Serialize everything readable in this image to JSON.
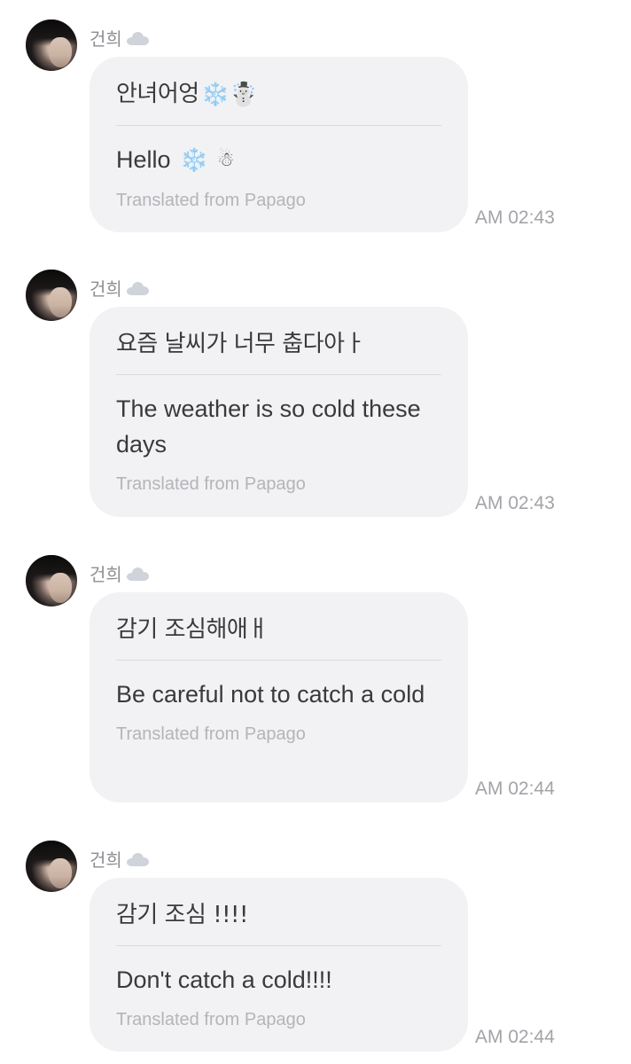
{
  "messages": [
    {
      "sender": "건희",
      "sender_icon": "cloud-icon",
      "original_text": "안녀어엉",
      "original_emojis": [
        "❄️",
        "☃️"
      ],
      "translated_text": "Hello",
      "translated_emojis": [
        "❄️",
        "☃"
      ],
      "source": "Translated from Papago",
      "time": "AM 02:43"
    },
    {
      "sender": "건희",
      "sender_icon": "cloud-icon",
      "original_text": "요즘 날씨가 너무 춥다아ㅏ",
      "translated_text": "The weather is so cold these days",
      "source": "Translated from Papago",
      "time": "AM 02:43"
    },
    {
      "sender": "건희",
      "sender_icon": "cloud-icon",
      "original_text": "감기 조심해애ㅐ",
      "translated_text": "Be careful not to catch a cold",
      "source": "Translated from Papago",
      "time": "AM 02:44"
    },
    {
      "sender": "건희",
      "sender_icon": "cloud-icon",
      "original_text": "감기 조심 !!!!",
      "translated_text": "Don't catch a cold!!!!",
      "source": "Translated from Papago",
      "time": "AM 02:44"
    }
  ],
  "colors": {
    "bubble_bg": "#f2f2f4",
    "text": "#3a3a3c",
    "muted": "#b4b4b9",
    "time": "#a3a3a8",
    "snowflake": "#6fb9ea"
  }
}
